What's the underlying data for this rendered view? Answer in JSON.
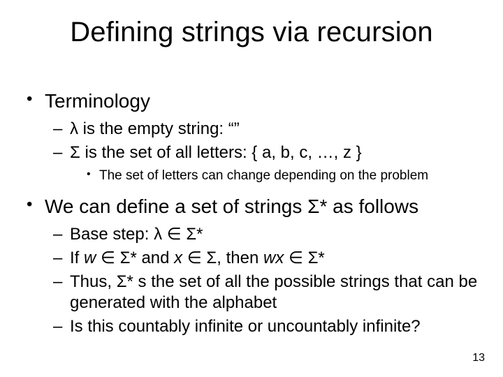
{
  "title": "Defining strings via recursion",
  "page": "13",
  "top1": "Terminology",
  "sub1a_pre": "λ",
  "sub1a_post": " is the empty string: “”",
  "sub1b_pre": "Σ",
  "sub1b_post": " is the set of all letters: { a, b, c, …, z }",
  "sub1b_note": "The set of letters can change depending on the problem",
  "top2_pre": "We can define a set of strings ",
  "top2_sym": "Σ",
  "top2_post": "* as follows",
  "s2a_1": "Base step: ",
  "s2a_lam": "λ",
  "s2a_in": " ∈ ",
  "s2a_sig": "Σ",
  "s2a_star": "*",
  "s2b_1": "If ",
  "s2b_w": "w",
  "s2b_in1": " ∈ ",
  "s2b_sig1": "Σ",
  "s2b_star1": "* and ",
  "s2b_x": "x",
  "s2b_in2": " ∈ ",
  "s2b_sig2": "Σ",
  "s2b_mid": ", then ",
  "s2b_wx": "wx",
  "s2b_in3": " ∈ ",
  "s2b_sig3": "Σ",
  "s2b_star3": "*",
  "s2c_1": "Thus, ",
  "s2c_sig": "Σ",
  "s2c_2": "* s the set of all the possible strings that can be generated with the alphabet",
  "s2d": "Is this countably infinite or uncountably infinite?"
}
